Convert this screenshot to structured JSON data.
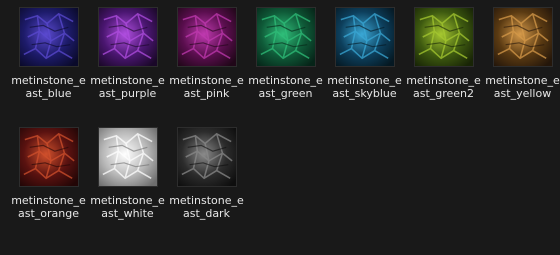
{
  "files": [
    {
      "name": "metinstone_east_blue",
      "colors": [
        "#1d1b6a",
        "#5b4ad0",
        "#0a0a2a"
      ]
    },
    {
      "name": "metinstone_east_purple",
      "colors": [
        "#4a1670",
        "#b04ee0",
        "#1a0828"
      ]
    },
    {
      "name": "metinstone_east_pink",
      "colors": [
        "#5a0e4e",
        "#c03ab0",
        "#200718"
      ]
    },
    {
      "name": "metinstone_east_green",
      "colors": [
        "#0f5a38",
        "#2fbf7a",
        "#062418"
      ]
    },
    {
      "name": "metinstone_east_skyblue",
      "colors": [
        "#0d3f5c",
        "#3aa8d6",
        "#051822"
      ]
    },
    {
      "name": "metinstone_east_green2",
      "colors": [
        "#3e5a10",
        "#a6c830",
        "#182406"
      ]
    },
    {
      "name": "metinstone_east_yellow",
      "colors": [
        "#5a3a12",
        "#d69a4a",
        "#24160a"
      ]
    },
    {
      "name": "metinstone_east_orange",
      "colors": [
        "#5a1210",
        "#d0502c",
        "#220606"
      ]
    },
    {
      "name": "metinstone_east_white",
      "colors": [
        "#b8b8b8",
        "#ffffff",
        "#6e6e6e"
      ]
    },
    {
      "name": "metinstone_east_dark",
      "colors": [
        "#2c2c2c",
        "#8a8a8a",
        "#0e0e0e"
      ]
    }
  ]
}
